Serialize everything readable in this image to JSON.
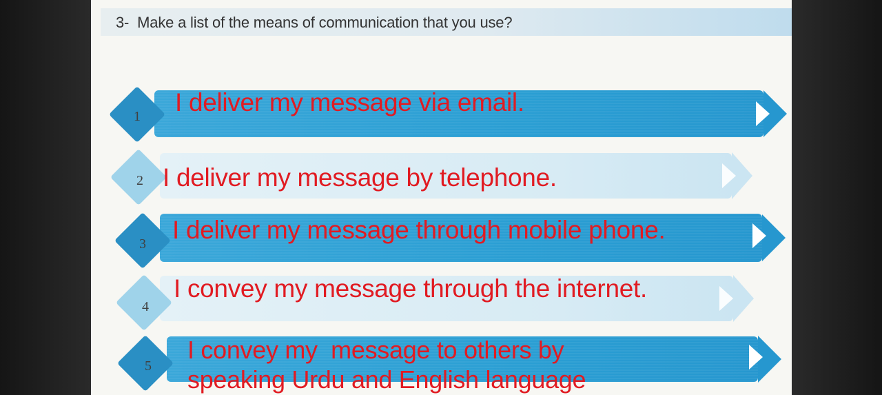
{
  "question": {
    "number": "3-",
    "text": "Make a list of the means of communication that you use?"
  },
  "items": [
    {
      "num": "1",
      "text": "I deliver my message via email.",
      "style": "dark"
    },
    {
      "num": "2",
      "text": "I deliver my message by telephone.",
      "style": "light"
    },
    {
      "num": "3",
      "text": "I deliver my message through mobile phone.",
      "style": "dark"
    },
    {
      "num": "4",
      "text": "I convey my message through the internet.",
      "style": "light"
    },
    {
      "num": "5",
      "line1": "I convey my  message to others by",
      "line2": "speaking Urdu and English language",
      "style": "dark"
    }
  ],
  "colors": {
    "answer_text": "#e11b22",
    "band_dark": "#2a9ed3",
    "band_light": "#d7ebf4"
  }
}
